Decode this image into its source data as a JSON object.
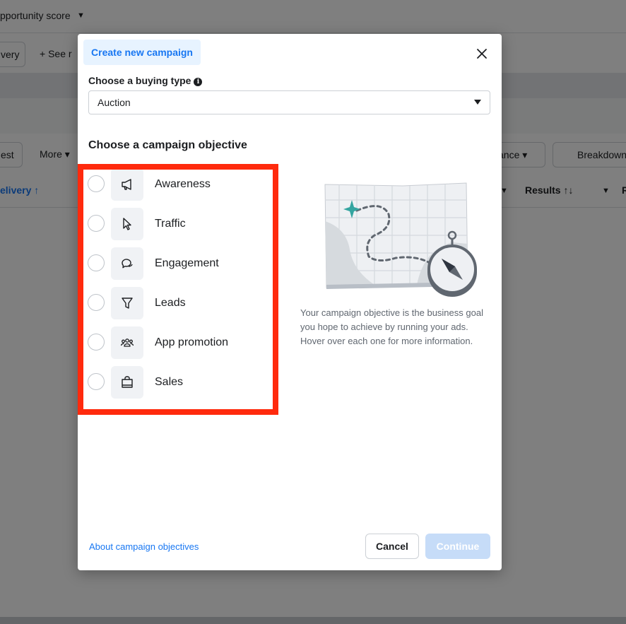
{
  "background": {
    "top_filter": "pportunity score",
    "delivery_button": "very",
    "see_button": "See r",
    "test_button": "est",
    "more_button": "More",
    "performance_button": "ance",
    "breakdown_button": "Breakdown",
    "col_delivery": "elivery ↑",
    "col_results": "Results ↑↓",
    "col_r": "R"
  },
  "modal": {
    "tab_label": "Create new campaign",
    "buying_type_label": "Choose a buying type",
    "buying_type_value": "Auction",
    "objective_heading": "Choose a campaign objective",
    "objectives": [
      {
        "label": "Awareness",
        "icon": "megaphone-icon"
      },
      {
        "label": "Traffic",
        "icon": "cursor-icon"
      },
      {
        "label": "Engagement",
        "icon": "chat-bubbles-icon"
      },
      {
        "label": "Leads",
        "icon": "funnel-icon"
      },
      {
        "label": "App promotion",
        "icon": "people-icon"
      },
      {
        "label": "Sales",
        "icon": "shopping-bag-icon"
      }
    ],
    "description": "Your campaign objective is the business goal you hope to achieve by running your ads. Hover over each one for more information.",
    "about_link": "About campaign objectives",
    "cancel_label": "Cancel",
    "continue_label": "Continue"
  },
  "colors": {
    "accent": "#1877f2",
    "highlight": "#ff2a0d",
    "continue_disabled": "#c6dcf8"
  }
}
